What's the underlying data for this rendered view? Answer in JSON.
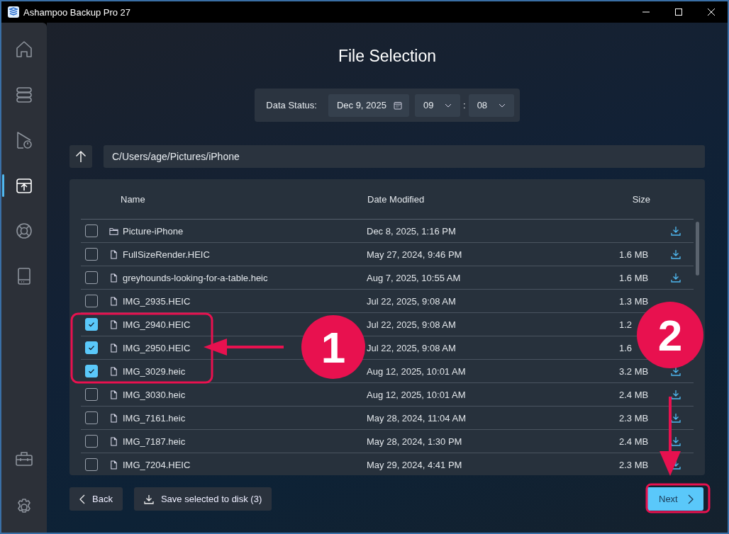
{
  "window": {
    "title": "Ashampoo Backup Pro 27"
  },
  "sidebar": {
    "items": [
      {
        "kind": "home",
        "selected": false
      },
      {
        "kind": "stack",
        "selected": false
      },
      {
        "kind": "play",
        "selected": false
      },
      {
        "kind": "restore",
        "selected": true
      },
      {
        "kind": "lifebuoy",
        "selected": false
      },
      {
        "kind": "drive",
        "selected": false
      }
    ],
    "bottom_items": [
      {
        "kind": "toolbox",
        "selected": false
      },
      {
        "kind": "settings",
        "selected": false
      }
    ]
  },
  "heading": "File Selection",
  "data_status": {
    "label": "Data Status:",
    "date": "Dec 9, 2025",
    "hour": "09",
    "separator": ":",
    "minute": "08"
  },
  "path": "C/Users/age/Pictures/iPhone",
  "table": {
    "columns": [
      "Name",
      "Date Modified",
      "Size"
    ],
    "rows": [
      {
        "kind": "folder",
        "name": "Picture-iPhone",
        "date": "Dec 8, 2025, 1:16 PM",
        "checked": false,
        "download_icon": true
      },
      {
        "kind": "file",
        "name": "FullSizeRender.HEIC",
        "date": "May 27, 2024, 9:46 PM",
        "size": "1.6 MB",
        "checked": false,
        "download_icon": true
      },
      {
        "kind": "file",
        "name": "greyhounds-looking-for-a-table.heic",
        "date": "Aug 7, 2025, 10:55 AM",
        "size": "1.6 MB",
        "checked": false,
        "download_icon": true
      },
      {
        "kind": "file",
        "name": "IMG_2935.HEIC",
        "date": "Jul 22, 2025, 9:08 AM",
        "size": "1.3 MB",
        "checked": false,
        "download_icon": false
      },
      {
        "kind": "file",
        "name": "IMG_2940.HEIC",
        "date": "Jul 22, 2025, 9:08 AM",
        "size": "1.2",
        "checked": true,
        "download_icon": false
      },
      {
        "kind": "file",
        "name": "IMG_2950.HEIC",
        "date": "Jul 22, 2025, 9:08 AM",
        "size": "1.6",
        "checked": true,
        "download_icon": false
      },
      {
        "kind": "file",
        "name": "IMG_3029.heic",
        "date": "Aug 12, 2025, 10:01 AM",
        "size": "3.2 MB",
        "checked": true,
        "download_icon": true
      },
      {
        "kind": "file",
        "name": "IMG_3030.heic",
        "date": "Aug 12, 2025, 10:01 AM",
        "size": "2.4 MB",
        "checked": false,
        "download_icon": true
      },
      {
        "kind": "file",
        "name": "IMG_7161.heic",
        "date": "May 28, 2024, 11:04 AM",
        "size": "2.3 MB",
        "checked": false,
        "download_icon": true
      },
      {
        "kind": "file",
        "name": "IMG_7187.heic",
        "date": "May 28, 2024, 1:30 PM",
        "size": "2.4 MB",
        "checked": false,
        "download_icon": true
      },
      {
        "kind": "file",
        "name": "IMG_7204.HEIC",
        "date": "May 29, 2024, 4:41 PM",
        "size": "2.3 MB",
        "checked": false,
        "download_icon": true
      }
    ]
  },
  "buttons": {
    "back": "Back",
    "save": "Save selected to disk (3)",
    "next": "Next"
  },
  "annotations": {
    "step_1": "1",
    "step_2": "2"
  }
}
